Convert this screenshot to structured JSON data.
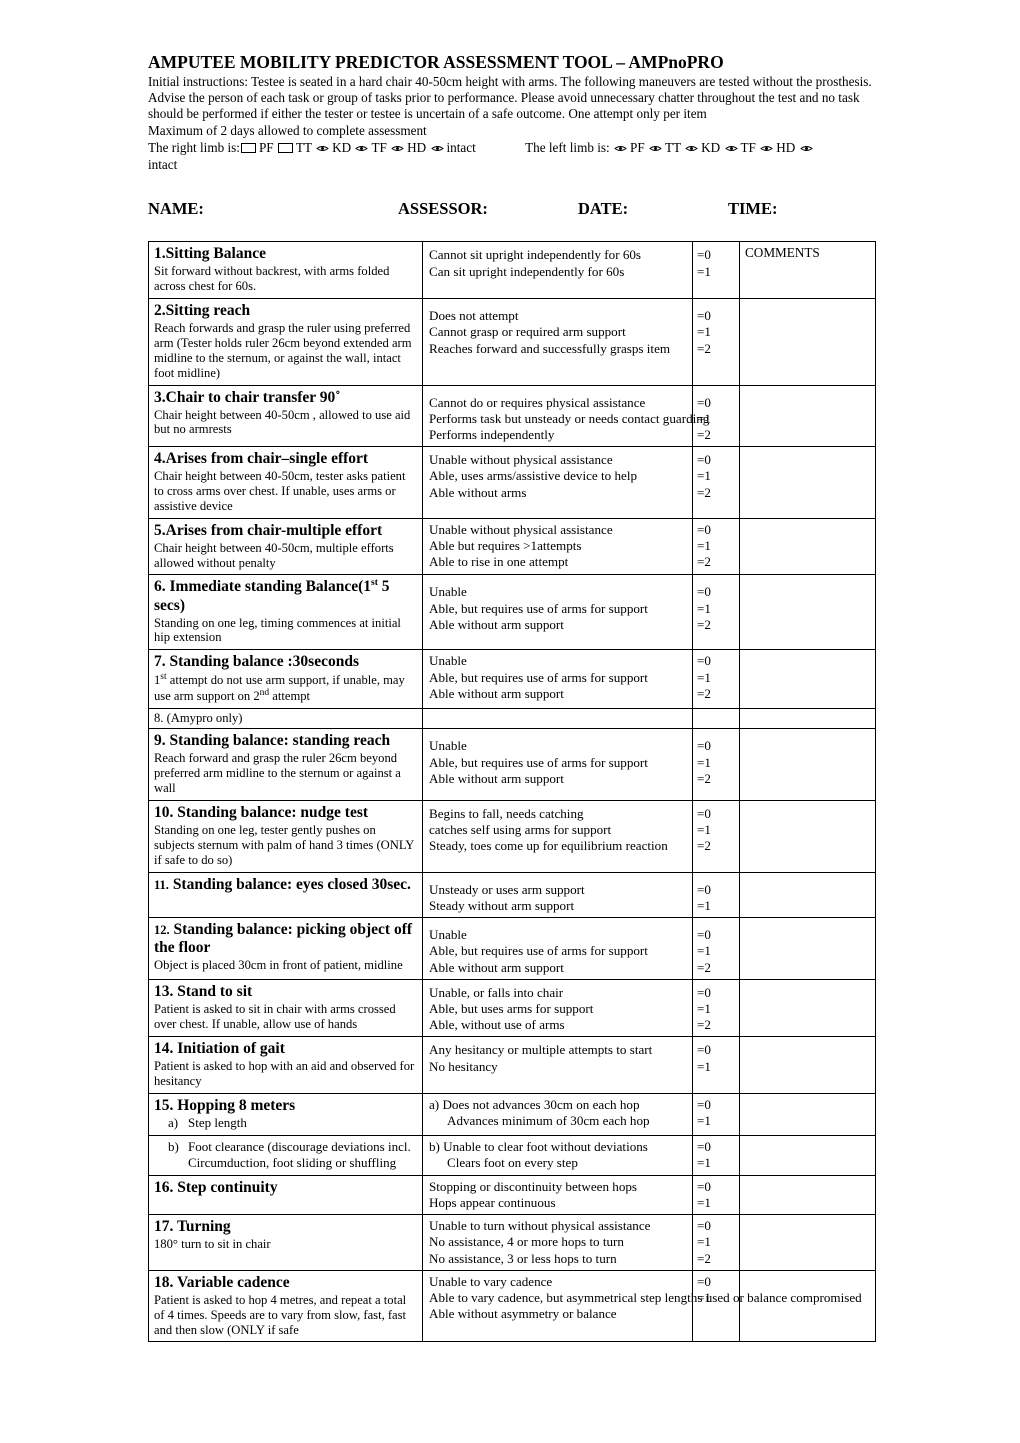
{
  "document": {
    "title": "AMPUTEE MOBILITY PREDICTOR ASSESSMENT TOOL – AMPnoPRO",
    "instructions_1": "Initial instructions:  Testee is seated in a hard chair 40-50cm height with arms.  The following maneuvers are tested without the prosthesis.  Advise the person of each task or group of tasks prior to performance.  Please avoid unnecessary chatter throughout the test and no task should be performed if either the tester or testee is uncertain of a safe outcome.  One attempt only per item",
    "instructions_2": "Maximum of 2 days allowed to complete assessment",
    "limb_right_label": "The right limb is:",
    "limb_left_label": "The left limb is:",
    "limb_options": [
      "PF",
      "TT",
      "KD",
      "TF",
      "HD",
      "intact"
    ],
    "header_fields": {
      "name": "NAME:",
      "assessor": "ASSESSOR:",
      "date": "DATE:",
      "time": "TIME:"
    },
    "comments_header": "COMMENTS"
  },
  "items": [
    {
      "title": "1.Sitting Balance",
      "desc": "Sit forward without backrest, with arms folded across chest for 60s.",
      "options": [
        "Cannot sit upright independently for 60s",
        "Can sit upright independently for 60s"
      ],
      "scores": [
        "=0",
        "=1"
      ]
    },
    {
      "title": "2.Sitting reach",
      "desc": "Reach forwards and grasp the ruler using preferred arm (Tester holds ruler 26cm beyond extended arm midline to the sternum, or against the wall, intact foot midline)",
      "options": [
        "Does not attempt",
        "Cannot grasp or required arm support",
        "Reaches forward and successfully grasps item"
      ],
      "scores": [
        "=0",
        "=1",
        "=2"
      ]
    },
    {
      "title": "3.Chair to chair transfer 90˚",
      "desc": "Chair height between 40-50cm , allowed to use aid but no armrests",
      "options": [
        "Cannot do or requires physical assistance",
        "Performs task but unsteady or needs contact guarding",
        "Performs independently"
      ],
      "scores": [
        "=0",
        "=1",
        "=2"
      ]
    },
    {
      "title": "4.Arises from chair–single effort",
      "desc": "Chair height between 40-50cm, tester asks patient to cross arms over chest.  If unable, uses arms or assistive device",
      "options": [
        "Unable without physical assistance",
        "Able, uses arms/assistive device to help",
        "Able without arms"
      ],
      "scores": [
        "=0",
        "=1",
        "=2"
      ]
    },
    {
      "title": "5.Arises from chair-multiple effort",
      "desc": "Chair height between 40-50cm, multiple efforts allowed without penalty",
      "options": [
        "Unable without physical assistance",
        "Able but requires >1attempts",
        "Able to rise in one attempt"
      ],
      "scores": [
        "=0",
        "=1",
        "=2"
      ]
    },
    {
      "title": "6. Immediate standing Balance(1st 5 secs)",
      "desc": "Standing on one leg, timing commences at initial hip extension",
      "options": [
        "Unable",
        "Able, but requires use of arms for support",
        "Able without arm support"
      ],
      "scores": [
        "=0",
        "=1",
        "=2"
      ]
    },
    {
      "title": "7. Standing balance :30seconds",
      "desc": "1st attempt do not use arm support, if unable, may use arm support on 2nd attempt",
      "options": [
        "Unable",
        "Able, but requires use of arms for support",
        "Able without arm support"
      ],
      "scores": [
        "=0",
        "=1",
        "=2"
      ]
    },
    {
      "title": "8. (Amypro only)",
      "desc": "",
      "options": [],
      "scores": []
    },
    {
      "title": "9.  Standing balance: standing reach",
      "desc": "Reach forward and grasp the ruler 26cm beyond preferred arm midline to the sternum or against a wall",
      "options": [
        "Unable",
        "Able, but requires use of arms for support",
        "Able without arm support"
      ],
      "scores": [
        "=0",
        "=1",
        "=2"
      ]
    },
    {
      "title": "10. Standing balance: nudge test",
      "desc": "Standing on one leg, tester gently pushes on subjects sternum with palm of hand 3 times (ONLY if safe to do so)",
      "options": [
        "Begins to fall, needs catching",
        "catches self using arms for support",
        "Steady, toes come up for equilibrium reaction"
      ],
      "scores": [
        "=0",
        "=1",
        "=2"
      ]
    },
    {
      "title": "11. Standing balance: eyes closed 30sec.",
      "desc": "",
      "options": [
        "Unsteady or uses arm support",
        "Steady without arm support"
      ],
      "scores": [
        "=0",
        "=1"
      ]
    },
    {
      "title": "12.  Standing balance: picking object off the floor",
      "desc": "Object is placed 30cm in front of patient, midline",
      "options": [
        "Unable",
        "Able, but requires use of arms for support",
        "Able without arm support"
      ],
      "scores": [
        "=0",
        "=1",
        "=2"
      ]
    },
    {
      "title": "13.  Stand to sit",
      "desc": "Patient is asked to sit in chair with arms crossed over chest.  If unable, allow use of hands",
      "options": [
        "Unable, or falls into chair",
        "Able, but uses arms for support",
        "Able, without use of arms"
      ],
      "scores": [
        "=0",
        "=1",
        "=2"
      ]
    },
    {
      "title": "14.  Initiation of gait",
      "desc": "Patient is asked to hop with an aid and observed for hesitancy",
      "options": [
        "Any hesitancy or multiple attempts to start",
        "No hesitancy"
      ],
      "scores": [
        "=0",
        "=1"
      ]
    },
    {
      "title": "15.  Hopping 8 meters",
      "desc": "",
      "sub_a_label": "a)",
      "sub_a_text": "Step length",
      "sub_b_label": "b)",
      "sub_b_text": "Foot clearance (discourage deviations incl. Circumduction, foot sliding or shuffling",
      "options_a": [
        "a) Does not advances 30cm on each hop",
        "Advances minimum of 30cm each hop"
      ],
      "scores_a": [
        "=0",
        "=1"
      ],
      "options_b": [
        "b)  Unable to clear foot without deviations",
        "Clears foot on every step"
      ],
      "scores_b": [
        "=0",
        "=1"
      ]
    },
    {
      "title": "16.  Step continuity",
      "desc": "",
      "options": [
        "Stopping or discontinuity between hops",
        "Hops appear continuous"
      ],
      "scores": [
        "=0",
        "=1"
      ]
    },
    {
      "title": "17. Turning",
      "desc": "180° turn to sit in chair",
      "options": [
        "Unable to turn without physical assistance",
        "No assistance, 4 or more hops to turn",
        "No assistance, 3 or less hops to turn"
      ],
      "scores": [
        "=0",
        "=1",
        "=2"
      ]
    },
    {
      "title": "18.  Variable cadence",
      "desc": "Patient is asked to hop 4 metres, and repeat a total of 4 times. Speeds are to vary from slow, fast, fast and then slow (ONLY if safe",
      "options": [
        "Unable to vary cadence",
        "Able to vary cadence, but asymmetrical step lengths used or balance compromised",
        "Able without asymmetry or balance"
      ],
      "scores": [
        "=0",
        "",
        "=1"
      ]
    }
  ]
}
